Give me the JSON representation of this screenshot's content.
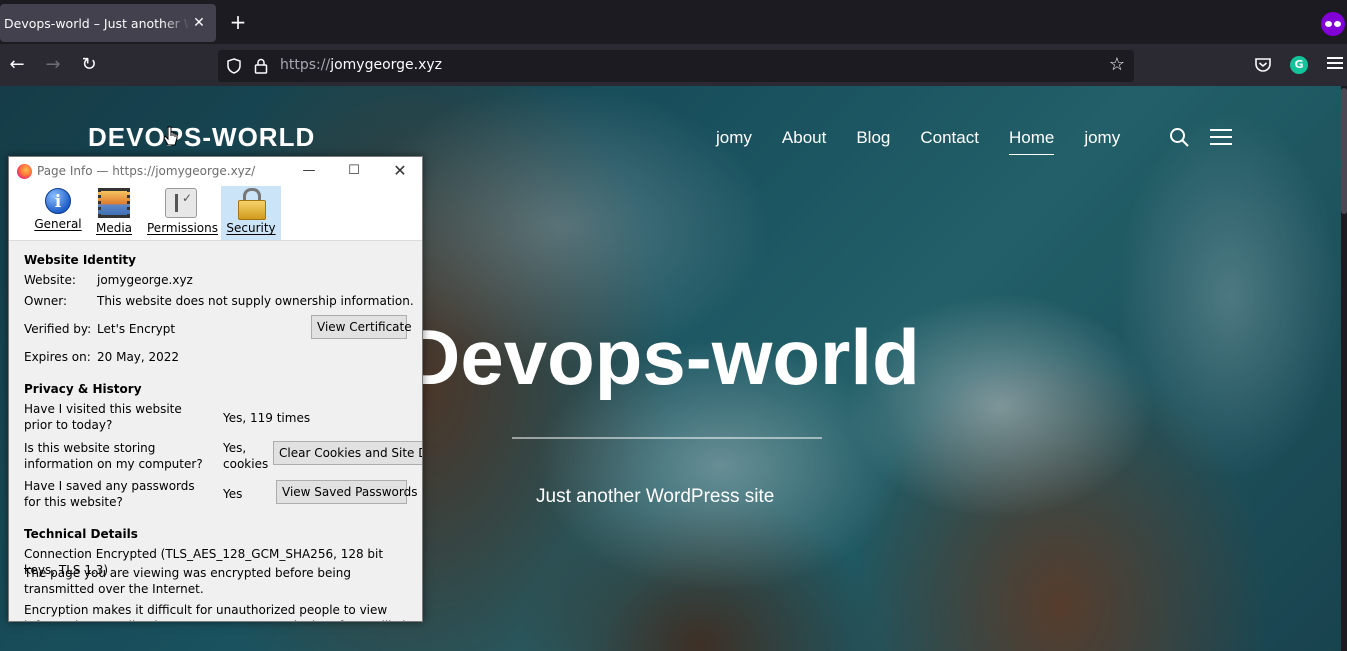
{
  "browser": {
    "tab_title": "Devops-world – Just another WordPress site",
    "url_protocol": "https://",
    "url_domain": "jomygeorge.xyz"
  },
  "site": {
    "title": "DEVOPS-WORLD",
    "nav": [
      "jomy",
      "About",
      "Blog",
      "Contact",
      "Home",
      "jomy"
    ],
    "active_nav": "Home",
    "hero_title": "Devops-world",
    "hero_subtitle": "Just another WordPress site"
  },
  "dialog": {
    "title": "Page Info — https://jomygeorge.xyz/",
    "tabs": [
      "General",
      "Media",
      "Permissions",
      "Security"
    ],
    "selected_tab": "Security",
    "identity": {
      "heading": "Website Identity",
      "website_label": "Website:",
      "website_value": "jomygeorge.xyz",
      "owner_label": "Owner:",
      "owner_value": "This website does not supply ownership information.",
      "verified_label": "Verified by:",
      "verified_value": "Let's Encrypt",
      "view_cert_button": "View Certificate",
      "expires_label": "Expires on:",
      "expires_value": "20 May, 2022"
    },
    "privacy": {
      "heading": "Privacy & History",
      "visited_q": "Have I visited this website prior to today?",
      "visited_a": "Yes, 119 times",
      "storing_q": "Is this website storing information on my computer?",
      "storing_a": "Yes, cookies",
      "clear_button": "Clear Cookies and Site Data",
      "passwords_q": "Have I saved any passwords for this website?",
      "passwords_a": "Yes",
      "view_passwords_button": "View Saved Passwords"
    },
    "technical": {
      "heading": "Technical Details",
      "connection": "Connection Encrypted (TLS_AES_128_GCM_SHA256, 128 bit keys, TLS 1.3)",
      "para1": "The page you are viewing was encrypted before being transmitted over the Internet.",
      "para2": "Encryption makes it difficult for unauthorized people to view information traveling between computers. It is therefore unlikely that anyone read this page as it traveled across the network."
    }
  }
}
